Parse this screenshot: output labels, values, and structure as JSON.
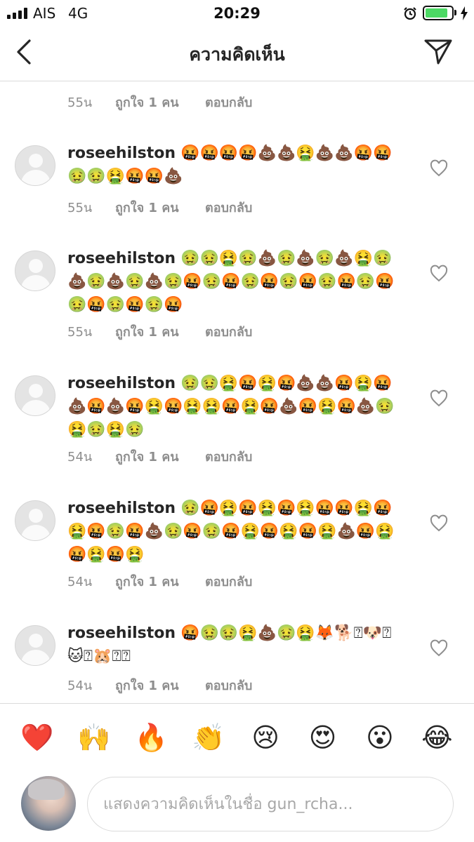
{
  "status_bar": {
    "carrier": "AIS",
    "network": "4G",
    "time": "20:29",
    "battery_level": 0.85,
    "battery_color": "#4cd964"
  },
  "header": {
    "title": "ความคิดเห็น",
    "back_icon": "chevron-left-icon",
    "send_icon": "paper-plane-icon"
  },
  "top_meta": {
    "time": "55น",
    "likes": "ถูกใจ 1 คน",
    "reply": "ตอบกลับ"
  },
  "comments": [
    {
      "username": "roseehilston",
      "text": "🤬🤬🤬🤬💩💩🤮💩💩🤬🤬🤢🤢🤮🤬🤬💩",
      "time": "55น",
      "likes": "ถูกใจ 1 คน",
      "reply": "ตอบกลับ"
    },
    {
      "username": "roseehilston",
      "text": "🤢🤢🤮🤢💩🤢💩🤢💩🤮🤢💩🤢💩🤢💩🤢🤬🤢🤬🤢🤬🤢🤬🤢🤬🤢🤬🤢🤬🤢🤬🤢🤬",
      "time": "55น",
      "likes": "ถูกใจ 1 คน",
      "reply": "ตอบกลับ"
    },
    {
      "username": "roseehilston",
      "text": "🤢🤢🤮🤬🤮🤬💩💩🤬🤮🤬💩🤬💩🤬🤮🤬🤮🤮🤬🤮🤬💩🤬🤮🤬💩🤢🤮🤢🤮🤢",
      "time": "54น",
      "likes": "ถูกใจ 1 คน",
      "reply": "ตอบกลับ"
    },
    {
      "username": "roseehilston",
      "text": "🤢🤬🤮🤬🤮🤬🤮🤬🤬🤮🤬🤮🤬🤢🤬💩🤢🤬🤢🤬🤮🤬🤮🤬🤮💩🤬🤮🤬🤮🤬🤮",
      "time": "54น",
      "likes": "ถูกใจ 1 คน",
      "reply": "ตอบกลับ"
    },
    {
      "username": "roseehilston",
      "text": "🤬🤢🤢🤮💩🤢🤮🦊🐕⍰🐶⍰🐱⍰🐹⍰⍰",
      "time": "54น",
      "likes": "ถูกใจ 1 คน",
      "reply": "ตอบกลับ"
    }
  ],
  "emoji_bar": [
    "❤️",
    "🙌",
    "🔥",
    "👏",
    "😢",
    "😍",
    "😮",
    "😂"
  ],
  "input": {
    "placeholder": "แสดงความคิดเห็นในชื่อ gun_rcha..."
  }
}
